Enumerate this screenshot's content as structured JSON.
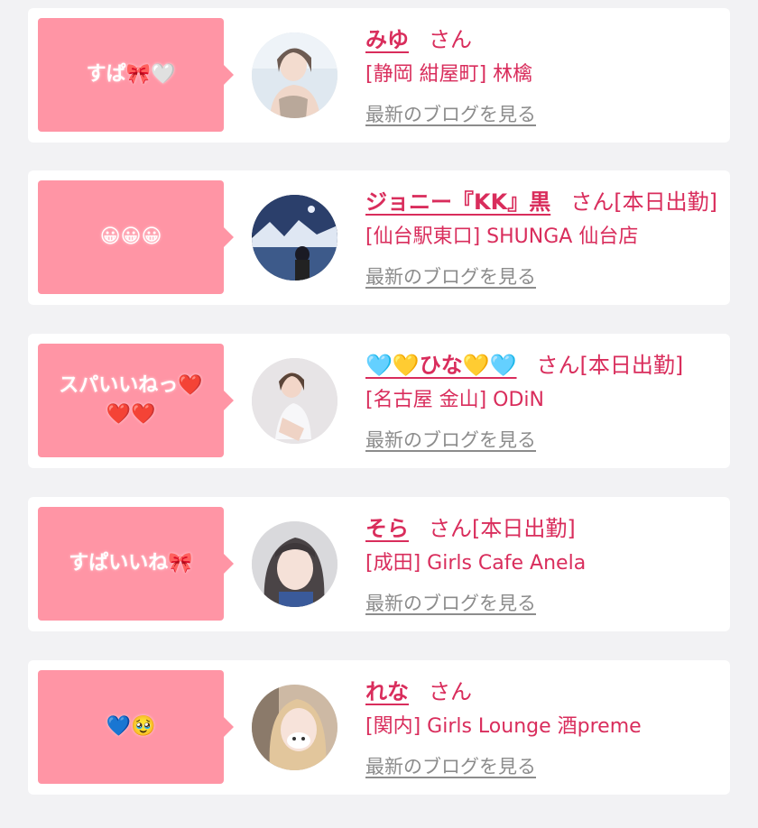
{
  "cards": [
    {
      "comment": "すぱ🎀🤍",
      "name": "みゆ",
      "suffix": "さん",
      "status": "",
      "shop": "[静岡 紺屋町] 林檎",
      "link": "最新のブログを見る",
      "avatar_icon": "profile-photo"
    },
    {
      "comment": "😀😀😀",
      "name": "ジョニー『KK』黒",
      "suffix": "さん",
      "status": "[本日出勤]",
      "shop": "[仙台駅東口] SHUNGA 仙台店",
      "link": "最新のブログを見る",
      "avatar_icon": "profile-photo"
    },
    {
      "comment": "スパいいねっ❤️❤️❤️",
      "name": "🩵💛ひな💛🩵",
      "suffix": "さん",
      "status": "[本日出勤]",
      "shop": "[名古屋 金山] ODiN",
      "link": "最新のブログを見る",
      "avatar_icon": "profile-photo"
    },
    {
      "comment": "すぱいいね🎀",
      "name": "そら",
      "suffix": "さん",
      "status": "[本日出勤]",
      "shop": "[成田] Girls Cafe Anela",
      "link": "最新のブログを見る",
      "avatar_icon": "profile-photo"
    },
    {
      "comment": "💙🥹",
      "name": "れな",
      "suffix": "さん",
      "status": "",
      "shop": "[関内] Girls Lounge 酒preme",
      "link": "最新のブログを見る",
      "avatar_icon": "profile-photo"
    }
  ],
  "colors": {
    "accent": "#d92d5c",
    "bubble": "#ff95a5",
    "link_gray": "#8c8c8c",
    "page_bg": "#f2f2f4"
  }
}
